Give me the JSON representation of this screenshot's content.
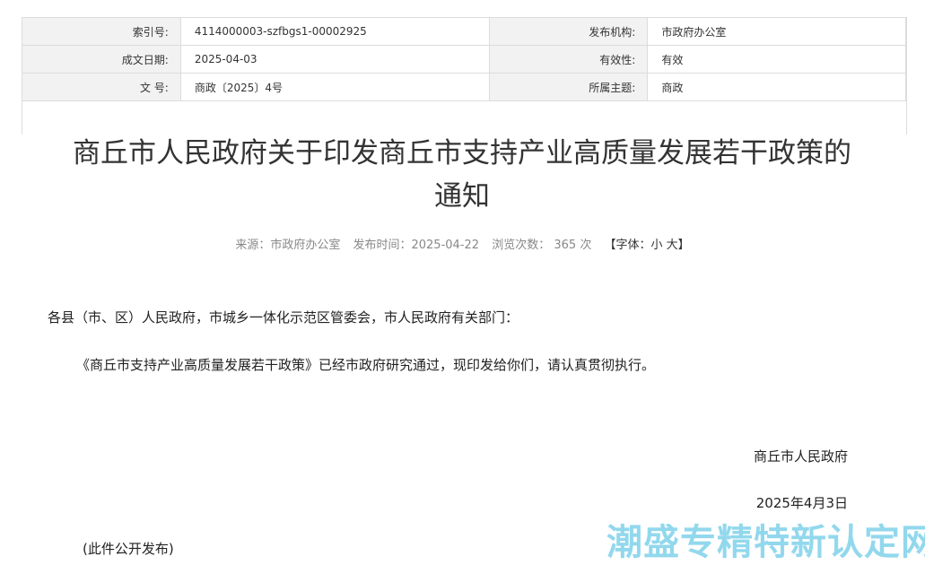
{
  "meta": {
    "rows": [
      {
        "l1": "索引号:",
        "v1": "4114000003-szfbgs1-00002925",
        "l2": "发布机构:",
        "v2": "市政府办公室"
      },
      {
        "l1": "成文日期:",
        "v1": "2025-04-03",
        "l2": "有效性:",
        "v2": "有效"
      },
      {
        "l1": "文 号:",
        "v1": "商政〔2025〕4号",
        "l2": "所属主题:",
        "v2": "商政"
      }
    ]
  },
  "article": {
    "title_line1": "商丘市人民政府关于印发商丘市支持产业高质量发展若干政策的",
    "title_line2": "通知",
    "source": "来源：市政府办公室",
    "publish": "发布时间：2025-04-22",
    "views_label": "浏览次数：",
    "views_count": "365",
    "views_unit": "次",
    "font_label": "【字体：",
    "font_small": "小",
    "font_big": "大",
    "font_end": "】",
    "salutation": "各县（市、区）人民政府，市城乡一体化示范区管委会，市人民政府有关部门：",
    "body": "《商丘市支持产业高质量发展若干政策》已经市政府研究通过，现印发给你们，请认真贯彻执行。",
    "signer": "商丘市人民政府",
    "date": "2025年4月3日",
    "note": "(此件公开发布)"
  },
  "watermark": "潮盛专精特新认定网"
}
